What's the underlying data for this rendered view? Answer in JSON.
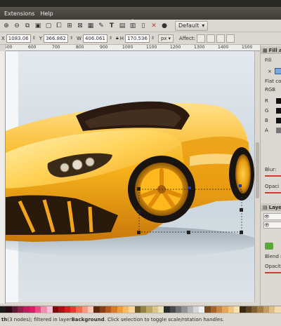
{
  "menubar": {
    "items": [
      "Extensions",
      "Help"
    ]
  },
  "command_bar": {
    "view_mode": "Default"
  },
  "tool_controls": {
    "x_label": "X",
    "x_value": "1083.06",
    "y_label": "Y",
    "y_value": "366.862",
    "w_label": "W",
    "w_value": "406.061",
    "h_label": "H",
    "h_value": "170.536",
    "unit": "px",
    "affect_label": "Affect:"
  },
  "ruler": {
    "ticks": [
      "500",
      "600",
      "700",
      "800",
      "900",
      "1000",
      "1100",
      "1200",
      "1300",
      "1400",
      "1500"
    ]
  },
  "dock": {
    "fill_stroke_title": "Fill a",
    "fill_tab": "Fill",
    "flat_color_label": "Flat co",
    "rgb_label": "RGB",
    "channels": [
      "R",
      "G",
      "B",
      "A"
    ],
    "blur_label": "Blur:",
    "opacity_label": "Opaci",
    "layers_title": "Laye",
    "blend_label": "Blend n",
    "opacity2_label": "Opacit"
  },
  "palette": [
    "#1a1a1a",
    "#2a0a12",
    "#5b1930",
    "#8c1f4a",
    "#b5205d",
    "#d4206b",
    "#e94b86",
    "#f28fb0",
    "#f7c3d4",
    "#7a0b0b",
    "#a31414",
    "#c82222",
    "#e03b2b",
    "#ef6b4f",
    "#f79b80",
    "#fbc8b8",
    "#5a2a0a",
    "#8a3e12",
    "#b3581a",
    "#d7782a",
    "#ee9b3c",
    "#f7bb66",
    "#fbd69a",
    "#6b5a2c",
    "#948043",
    "#bba662",
    "#d8c68b",
    "#ece0b6",
    "#2b2b2b",
    "#4a4a4a",
    "#6e6e6e",
    "#929292",
    "#b5b5b5",
    "#d6d6d6",
    "#f0f0f0",
    "#7a4a1c",
    "#a2642a",
    "#c98540",
    "#e3a55a",
    "#f2c47e",
    "#fce0ae",
    "#3a2a12",
    "#5c4320",
    "#7f5e30",
    "#a37c44",
    "#c49c60",
    "#e0bd85",
    "#f5dcb0"
  ],
  "status": {
    "bold": "th",
    "text": " (3 nodes); filtered in layer ",
    "layer": "Background",
    "tail": ". Click selection to toggle scale/rotation handles."
  }
}
